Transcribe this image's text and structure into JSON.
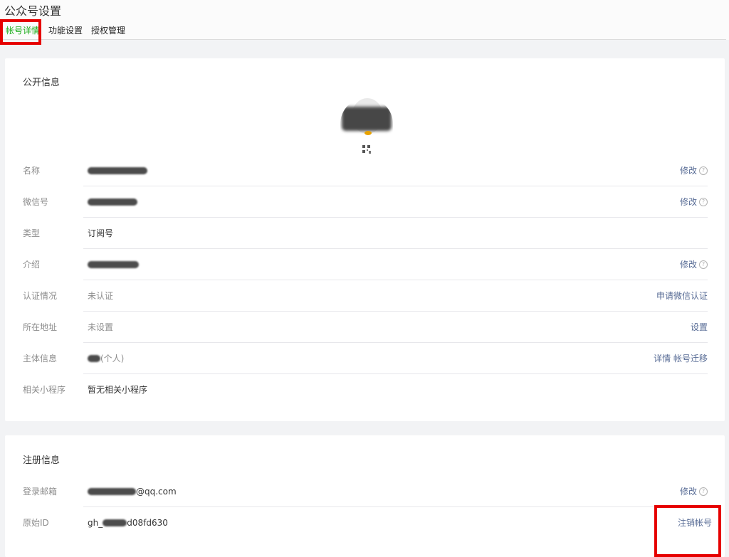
{
  "header": {
    "title": "公众号设置",
    "tabs": [
      {
        "label": "帐号详情"
      },
      {
        "label": "功能设置"
      },
      {
        "label": "授权管理"
      }
    ]
  },
  "public_info": {
    "title": "公开信息",
    "rows": [
      {
        "label": "名称",
        "value": "",
        "action": "修改"
      },
      {
        "label": "微信号",
        "value": "",
        "action": "修改"
      },
      {
        "label": "类型",
        "value": "订阅号",
        "action": ""
      },
      {
        "label": "介绍",
        "value": "",
        "action": "修改"
      },
      {
        "label": "认证情况",
        "value": "未认证",
        "action": "申请微信认证"
      },
      {
        "label": "所在地址",
        "value": "未设置",
        "action": "设置"
      },
      {
        "label": "主体信息",
        "value": "(个人)",
        "action_detail": "详情",
        "action_migrate": "帐号迁移"
      },
      {
        "label": "相关小程序",
        "value": "暂无相关小程序",
        "action": ""
      }
    ]
  },
  "register_info": {
    "title": "注册信息",
    "rows": [
      {
        "label": "登录邮箱",
        "value": "@qq.com",
        "action": "修改"
      },
      {
        "label": "原始ID",
        "value_prefix": "gh_",
        "value_suffix": "d08fd630",
        "action": "注销帐号"
      }
    ]
  },
  "icons": {
    "help": "question-circle-icon"
  },
  "colors": {
    "link": "#576b95",
    "active_tab": "#1aad19",
    "highlight": "#e60000"
  }
}
